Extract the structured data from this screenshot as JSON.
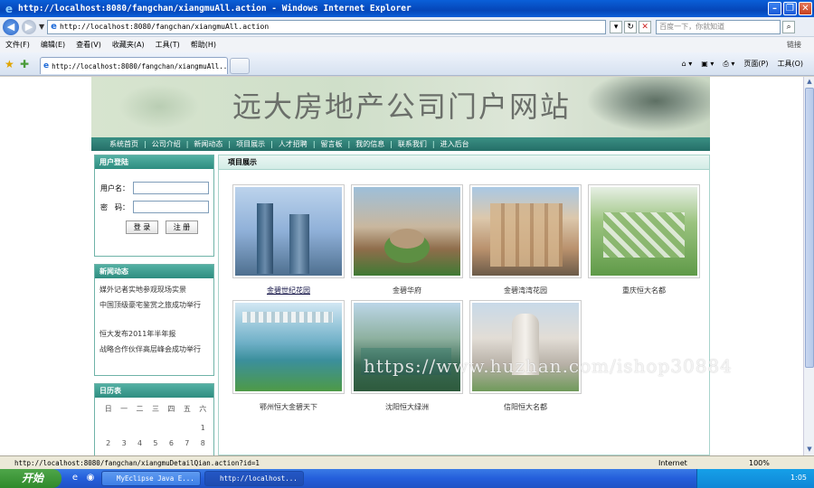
{
  "window": {
    "title": "http://localhost:8080/fangchan/xiangmuAll.action - Windows Internet Explorer"
  },
  "browser": {
    "address": "http://localhost:8080/fangchan/xiangmuAll.action",
    "search_placeholder": "百度一下，你就知道",
    "menu": [
      "文件(F)",
      "编辑(E)",
      "查看(V)",
      "收藏夹(A)",
      "工具(T)",
      "帮助(H)"
    ],
    "links_label": "链接",
    "tab_title": "http://localhost:8080/fangchan/xiangmuAll...",
    "page_menu": "页面(P)",
    "tools_menu": "工具(O)"
  },
  "site": {
    "title": "远大房地产公司门户网站",
    "nav": [
      "系统首页",
      "公司介绍",
      "新闻动态",
      "项目展示",
      "人才招聘",
      "留言板",
      "我的信息",
      "联系我们",
      "进入后台"
    ]
  },
  "login": {
    "heading": "用户登陆",
    "username_label": "用户名：",
    "password_label": "密　码：",
    "login_button": "登 录",
    "register_button": "注 册"
  },
  "news": {
    "heading": "新闻动态",
    "items": [
      "媒外记者实地参观现场实景",
      "中国顶级豪宅鉴赏之旅成功举行",
      "恒大发布2011年半年报",
      "战略合作伙伴高层峰会成功举行"
    ]
  },
  "calendar": {
    "heading": "日历表",
    "weekdays": [
      "日",
      "一",
      "二",
      "三",
      "四",
      "五",
      "六"
    ],
    "rows": [
      [
        "",
        "",
        "",
        "",
        "",
        "",
        "1"
      ],
      [
        "2",
        "3",
        "4",
        "5",
        "6",
        "7",
        "8"
      ]
    ]
  },
  "projects": {
    "heading": "项目展示",
    "items": [
      {
        "name": "金碧世纪花园"
      },
      {
        "name": "金碧华府"
      },
      {
        "name": "金碧湾湾花园"
      },
      {
        "name": "重庆恒大名都"
      },
      {
        "name": "鄂州恒大金碧天下"
      },
      {
        "name": "沈阳恒大绿洲"
      },
      {
        "name": "信阳恒大名都"
      }
    ]
  },
  "watermark": "https://www.huzhan.com/ishop30884",
  "status": {
    "url": "http://localhost:8080/fangchan/xiangmuDetailQian.action?id=1",
    "zone": "Internet",
    "zoom": "100%"
  },
  "taskbar": {
    "start": "开始",
    "tasks": [
      "MyEclipse Java E...",
      "http://localhost..."
    ],
    "clock": "1:05"
  }
}
